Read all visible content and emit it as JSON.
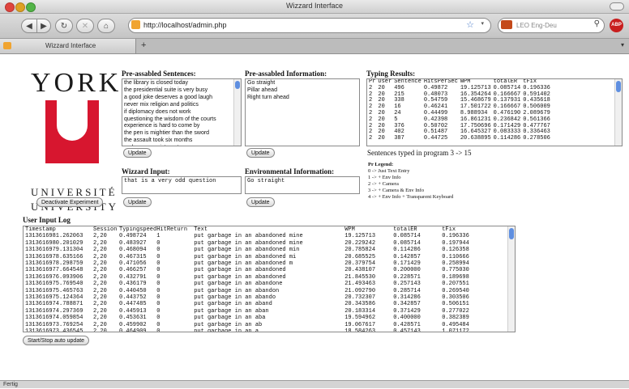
{
  "window": {
    "title": "Wizzard Interface"
  },
  "browser": {
    "url": "http://localhost/admin.php",
    "search_placeholder": "LEO Eng-Deu",
    "tab_label": "Wizzard Interface",
    "new_tab_label": "+",
    "status": "Fertig"
  },
  "logo": {
    "name": "YORK",
    "university_line1": "UNIVERSITÉ",
    "university_line2": "UNIVERSITY"
  },
  "buttons": {
    "deactivate": "Deactivate Experiment",
    "update": "Update",
    "start_stop": "Start/Stop auto update"
  },
  "sentences": {
    "title": "Pre-assabled Sentences:",
    "items": [
      "the library is closed today",
      "the presidential suite is very busy",
      "a good joke deserves a good laugh",
      "never mix religion and politics",
      "if diplomacy does not work",
      "questioning the wisdom of the courts",
      "experience is hard to come by",
      "the pen is mightier than the sword",
      "the assault took six months",
      "make an appointment"
    ]
  },
  "information": {
    "title": "Pre-assabled Information:",
    "items": [
      "Go straight",
      "Pillar ahead",
      "Right turn ahead"
    ]
  },
  "typing": {
    "title": "Typing Results:",
    "columns": [
      "Pr",
      "User",
      "Sentence",
      "HitsPerSec",
      "WPM",
      "totalER",
      "tFix"
    ],
    "rows": [
      [
        "2",
        "20",
        "496",
        "0.49872",
        "19.125713",
        "0.085714",
        "0.196336"
      ],
      [
        "2",
        "20",
        "215",
        "0.48073",
        "16.354264",
        "0.166667",
        "0.591402"
      ],
      [
        "2",
        "20",
        "338",
        "0.54759",
        "15.468679",
        "0.137931",
        "0.435618"
      ],
      [
        "2",
        "20",
        "16",
        "0.46241",
        "17.501722",
        "0.166667",
        "0.506009"
      ],
      [
        "2",
        "20",
        "24",
        "0.44499",
        "8.988934",
        "0.476190",
        "2.089679"
      ],
      [
        "2",
        "20",
        "5",
        "0.42398",
        "16.861231",
        "0.236842",
        "0.561366"
      ],
      [
        "2",
        "20",
        "376",
        "0.50702",
        "17.750696",
        "0.171429",
        "0.477767"
      ],
      [
        "2",
        "20",
        "402",
        "0.51487",
        "16.645327",
        "0.083333",
        "0.336463"
      ],
      [
        "2",
        "20",
        "387",
        "0.44725",
        "20.638895",
        "0.114286",
        "0.278506"
      ]
    ],
    "summary": "Sentences typed in program 3 -> 15"
  },
  "wizard_input": {
    "title": "Wizzard Input:",
    "value": "that is a very odd question"
  },
  "env_info": {
    "title": "Environmental Information:",
    "value": "Go straight"
  },
  "legend": {
    "title": "Pr Legend:",
    "items": [
      "0 -> Just Text Entry",
      "1 -> + Env Info",
      "2 -> + Camera",
      "3 -> + Camera & Env Info",
      "4 -> + Env Info + Transparent Keyboard"
    ]
  },
  "log": {
    "title": "User Input Log",
    "columns": [
      "Timestamp",
      "Session",
      "Typingspeed",
      "HitReturn",
      "Text",
      "WPM",
      "totalER",
      "tFix"
    ],
    "rows": [
      [
        "1313616981.262063",
        "2,20",
        "0.498724",
        "1",
        "put garbage in an abandoned mine",
        "19.125713",
        "0.085714",
        "0.196336"
      ],
      [
        "1313616980.201029",
        "2,20",
        "0.483927",
        "0",
        "put garbage in an abandoned mine",
        "20.229242",
        "0.085714",
        "0.197944"
      ],
      [
        "1313616979.131304",
        "2,20",
        "0.468094",
        "0",
        "put garbage in an abandoned min",
        "20.785824",
        "0.114286",
        "0.126358"
      ],
      [
        "1313616978.635166",
        "2,20",
        "0.467315",
        "0",
        "put garbage in an abandoned mi",
        "20.685525",
        "0.142857",
        "0.110666"
      ],
      [
        "1313616978.298759",
        "2,20",
        "0.471056",
        "0",
        "put garbage in an abandoned m",
        "20.379754",
        "0.171429",
        "0.258994"
      ],
      [
        "1313616977.664548",
        "2,20",
        "0.466257",
        "0",
        "put garbage in an abandoned",
        "20.438107",
        "0.200000",
        "0.775030"
      ],
      [
        "1313616976.093906",
        "2,20",
        "0.432791",
        "0",
        "put garbage in an abandoned",
        "21.845530",
        "0.228571",
        "0.189698"
      ],
      [
        "1313616975.769540",
        "2,20",
        "0.436179",
        "0",
        "put garbage in an abandone",
        "21.493463",
        "0.257143",
        "0.207551"
      ],
      [
        "1313616975.465763",
        "2,20",
        "0.440450",
        "0",
        "put garbage in an abandon",
        "21.092790",
        "0.285714",
        "0.269540"
      ],
      [
        "1313616975.124364",
        "2,20",
        "0.443752",
        "0",
        "put garbage in an abando",
        "20.732307",
        "0.314286",
        "0.303506"
      ],
      [
        "1313616974.788871",
        "2,20",
        "0.447485",
        "0",
        "put garbage in an aband",
        "20.343586",
        "0.342857",
        "0.506151"
      ],
      [
        "1313616974.297369",
        "2,20",
        "0.445913",
        "0",
        "put garbage in an aban",
        "20.183314",
        "0.371429",
        "0.277022"
      ],
      [
        "1313616974.059854",
        "2,20",
        "0.453631",
        "0",
        "put garbage in an aba",
        "19.594962",
        "0.400000",
        "0.382389"
      ],
      [
        "1313616973.769254",
        "2,20",
        "0.459902",
        "0",
        "put garbage in an ab",
        "19.067617",
        "0.428571",
        "0.495484"
      ],
      [
        "1313616973.436545",
        "2,20",
        "0.464909",
        "0",
        "put garbage in an a",
        "18.584263",
        "0.457143",
        "1.071172"
      ]
    ]
  },
  "icons": {
    "back": "back-arrow-icon",
    "forward": "forward-arrow-icon",
    "reload": "reload-icon",
    "stop": "stop-icon",
    "home": "home-icon",
    "star": "bookmark-star-icon",
    "abp": "adblock-icon"
  },
  "colors": {
    "york_red": "#d7162f",
    "scroll_thumb": "#5f8fe0"
  }
}
